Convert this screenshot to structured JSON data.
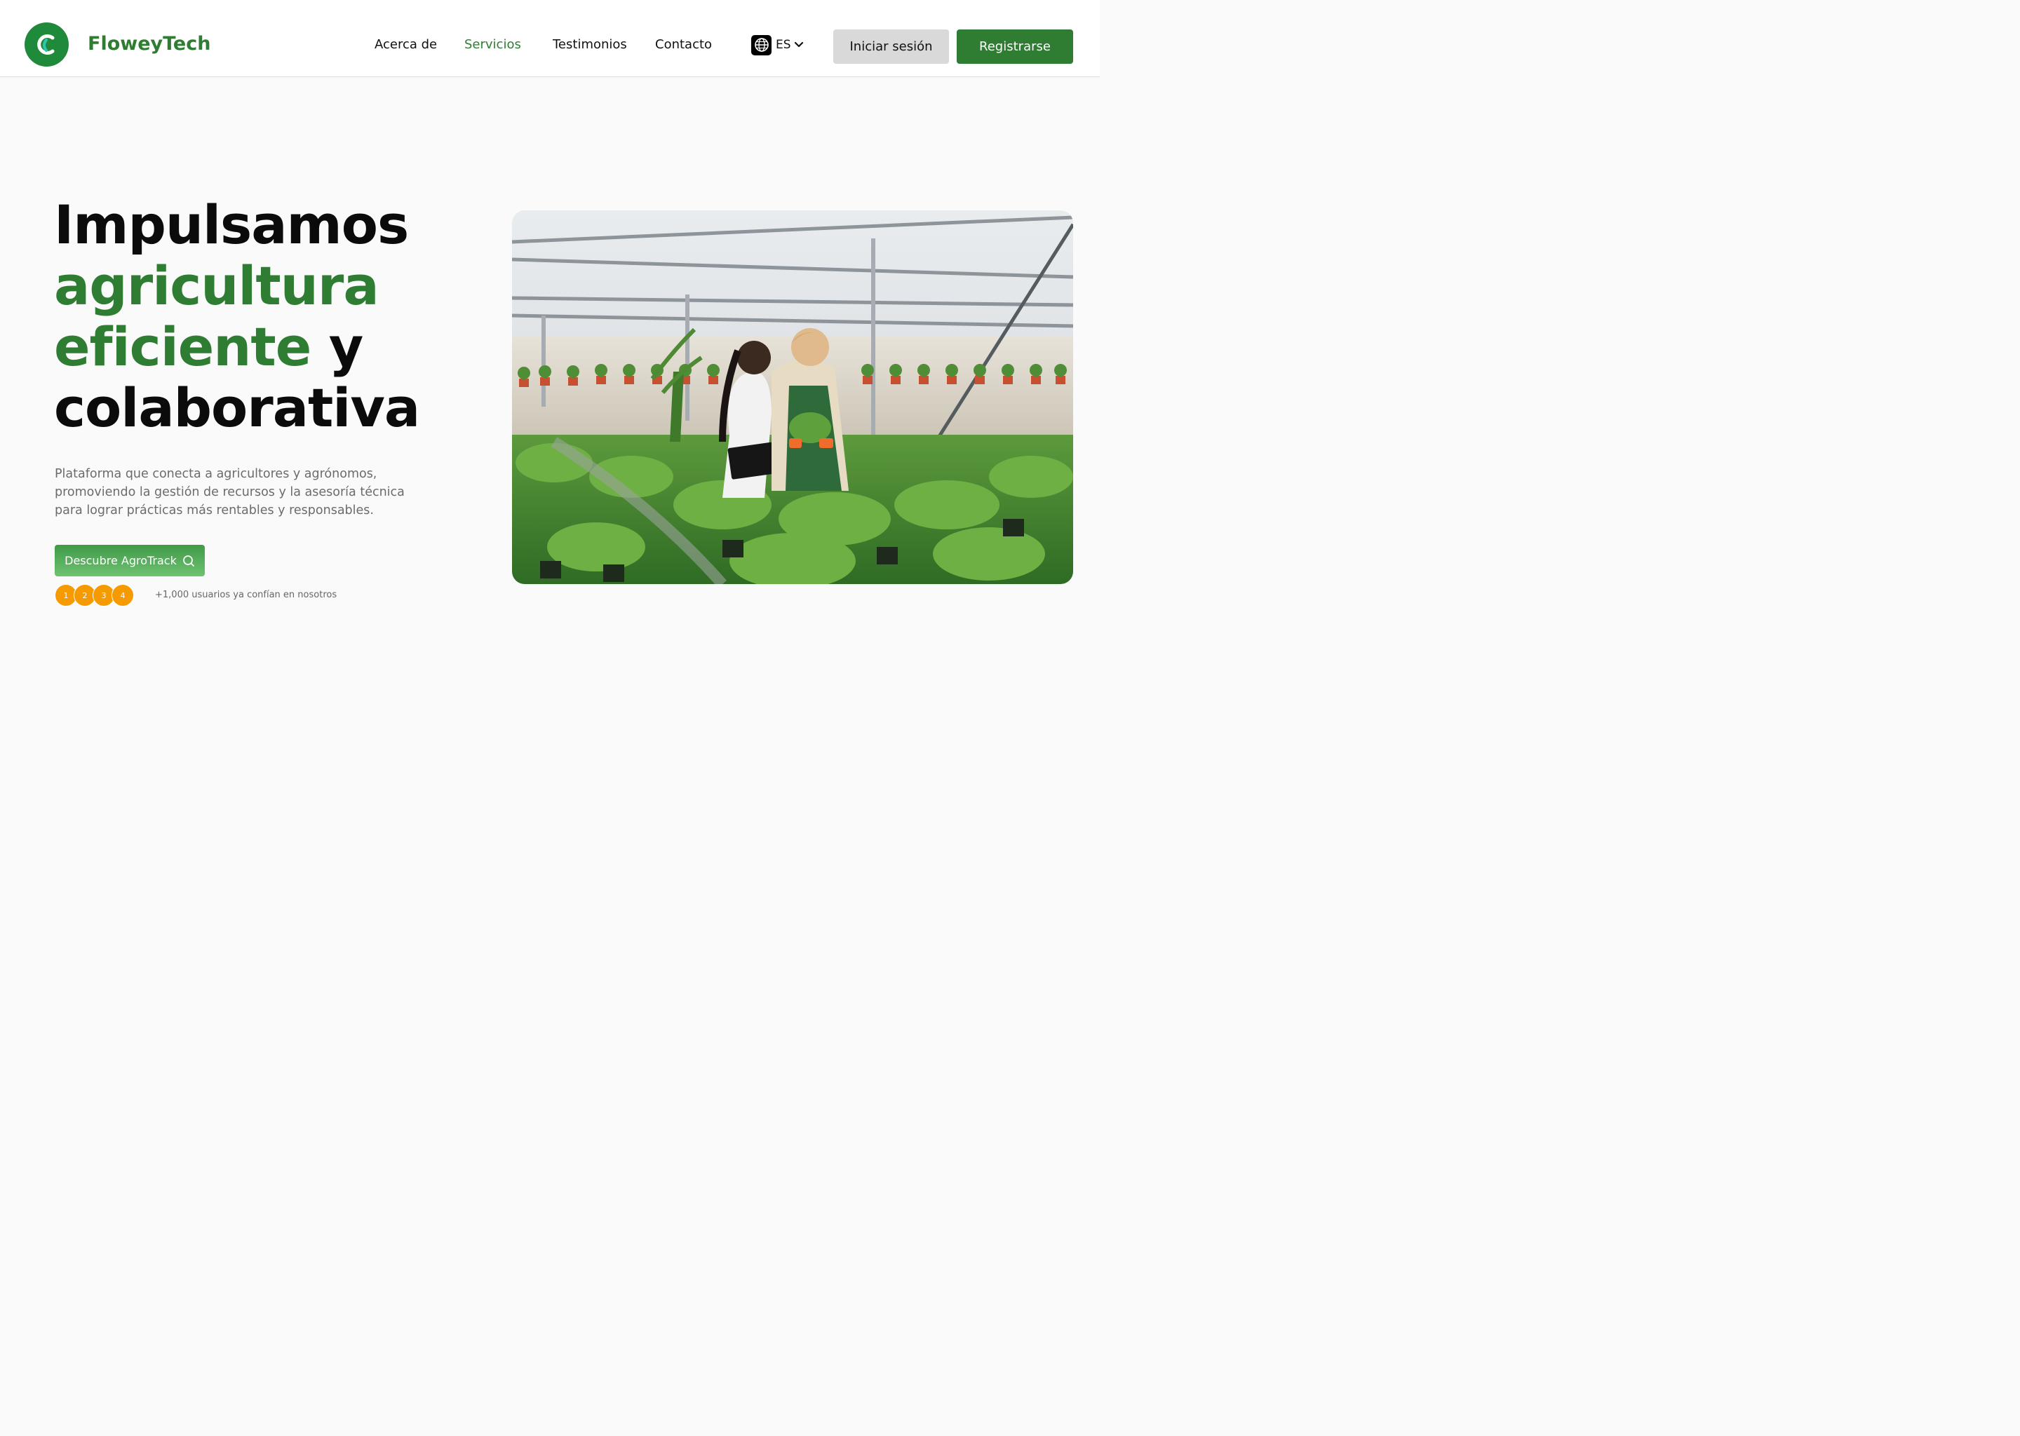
{
  "header": {
    "brand": "FloweyTech",
    "nav": [
      "Acerca de",
      "Servicios",
      "Testimonios",
      "Contacto"
    ],
    "active_nav": "Servicios",
    "language": "ES",
    "login_label": "Iniciar sesión",
    "register_label": "Registrarse"
  },
  "hero": {
    "title_line1": "Impulsamos",
    "title_line2": "agricultura",
    "title_line3_green": "eficiente",
    "title_line3_rest": "y",
    "title_line4": "colaborativa",
    "description": "Plataforma que conecta a agricultores y agrónomos, promoviendo la gestión de recursos y la asesoría técnica para lograr prácticas más rentables y responsables.",
    "cta_label": "Descubre AgroTrack",
    "avatars": [
      "1",
      "2",
      "3",
      "4"
    ],
    "social_proof": "+1,000 usuarios ya confían en nosotros"
  },
  "colors": {
    "brand_green": "#2e7d32",
    "logo_green": "#1f8a3a",
    "avatar_orange": "#f59a00",
    "login_bg": "#d9d9d9"
  },
  "icons": [
    "logo-mark-icon",
    "globe-icon",
    "chevron-down-icon",
    "search-icon"
  ]
}
